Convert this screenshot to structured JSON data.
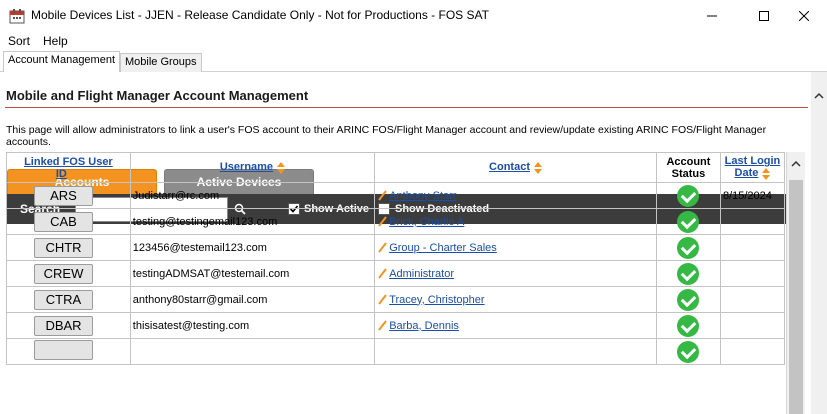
{
  "window": {
    "title": "Mobile Devices List - JJEN - Release Candidate Only - Not for Productions - FOS SAT"
  },
  "menu": {
    "sort": "Sort",
    "help": "Help"
  },
  "tabs": [
    {
      "label": "Account Management",
      "active": true
    },
    {
      "label": "Mobile Groups",
      "active": false
    }
  ],
  "page": {
    "header": "Mobile and Flight Manager Account Management",
    "description": "This page will allow administrators to link a user's FOS account to their ARINC FOS/Flight Manager account and review/update existing ARINC FOS/Flight Manager accounts."
  },
  "view_tabs": {
    "accounts": "Accounts",
    "active_devices": "Active Devices"
  },
  "toolbar": {
    "search_label": "Search",
    "search_value": "",
    "show_active_label": "Show Active",
    "show_active_checked": true,
    "show_deactivated_label": "Show Deactivated",
    "show_deactivated_checked": false
  },
  "grid": {
    "columns": {
      "linked_id_line1": "Linked FOS User",
      "linked_id_line2": "ID",
      "username": "Username",
      "contact": "Contact",
      "status_line1": "Account",
      "status_line2": "Status",
      "last_login": "Last Login Date"
    },
    "rows": [
      {
        "id": "ARS",
        "username": "Judistarr@rc.com",
        "contact": "Anthony Starr",
        "status": "active",
        "last_login": "8/15/2024"
      },
      {
        "id": "CAB",
        "username": "testing@testingemail123.com",
        "contact": "Brick, Charlie A",
        "status": "active",
        "last_login": ""
      },
      {
        "id": "CHTR",
        "username": "123456@testemail123.com",
        "contact": "Group - Charter Sales",
        "status": "active",
        "last_login": ""
      },
      {
        "id": "CREW",
        "username": "testingADMSAT@testemail.com",
        "contact": "Administrator",
        "status": "active",
        "last_login": ""
      },
      {
        "id": "CTRA",
        "username": "anthony80starr@gmail.com",
        "contact": "Tracey, Christopher",
        "status": "active",
        "last_login": ""
      },
      {
        "id": "DBAR",
        "username": "thisisatest@testing.com",
        "contact": "Barba, Dennis",
        "status": "active",
        "last_login": ""
      },
      {
        "id": "",
        "username": "",
        "contact": "",
        "status": "active",
        "last_login": ""
      }
    ]
  },
  "colors": {
    "accent_orange": "#f59321",
    "sort_arrow": "#f59321",
    "link_blue": "#1b4ea8",
    "status_green": "#35b844",
    "header_rule": "#c0504d",
    "toolbar_bg": "#3c3c3c"
  },
  "icons": {
    "app": "calendar-app-icon",
    "search": "search-icon",
    "edit": "pencil-icon",
    "status": "check-circle-icon"
  }
}
